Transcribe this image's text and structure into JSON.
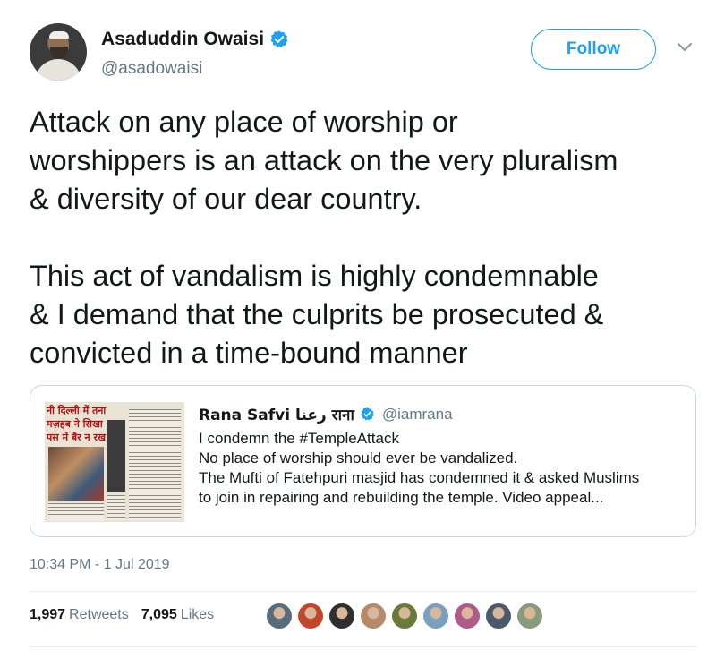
{
  "author": {
    "name": "Asaduddin Owaisi",
    "handle": "@asadowaisi",
    "verified": true
  },
  "follow_label": "Follow",
  "tweet": {
    "paragraphs": [
      [
        "Attack on any place of worship or",
        "worshippers is an attack on the very pluralism",
        "& diversity of our dear country."
      ],
      [
        "This act of vandalism is highly condemnable",
        "& I demand that the culprits be prosecuted &",
        "convicted in a time-bound manner"
      ]
    ]
  },
  "quote": {
    "name": "Rana Safvi رعنا राना",
    "handle": "@iamrana",
    "lines": [
      "I condemn the #TempleAttack",
      "No place of worship should ever be vandalized.",
      "The Mufti of Fatehpuri masjid has condemned it & asked Muslims",
      "to join in repairing and rebuilding the temple. Video appeal..."
    ],
    "thumb_headlines": [
      "नी दिल्ली में तना",
      "मज़हब ने सिखा",
      "पस में बैर न रख"
    ]
  },
  "timestamp": "10:34 PM - 1 Jul 2019",
  "stats": {
    "retweets_count": "1,997",
    "retweets_label": "Retweets",
    "likes_count": "7,095",
    "likes_label": "Likes"
  },
  "colors": {
    "accent": "#1da1f2",
    "secondary_text": "#657786",
    "border": "#ccd6dd"
  },
  "liker_colors": [
    "#5a6b7a",
    "#c2472a",
    "#2f2f2f",
    "#b48a6a",
    "#6a7a3a",
    "#7aa0c0",
    "#b05a8a",
    "#4a5a6a",
    "#8a9a7a"
  ]
}
